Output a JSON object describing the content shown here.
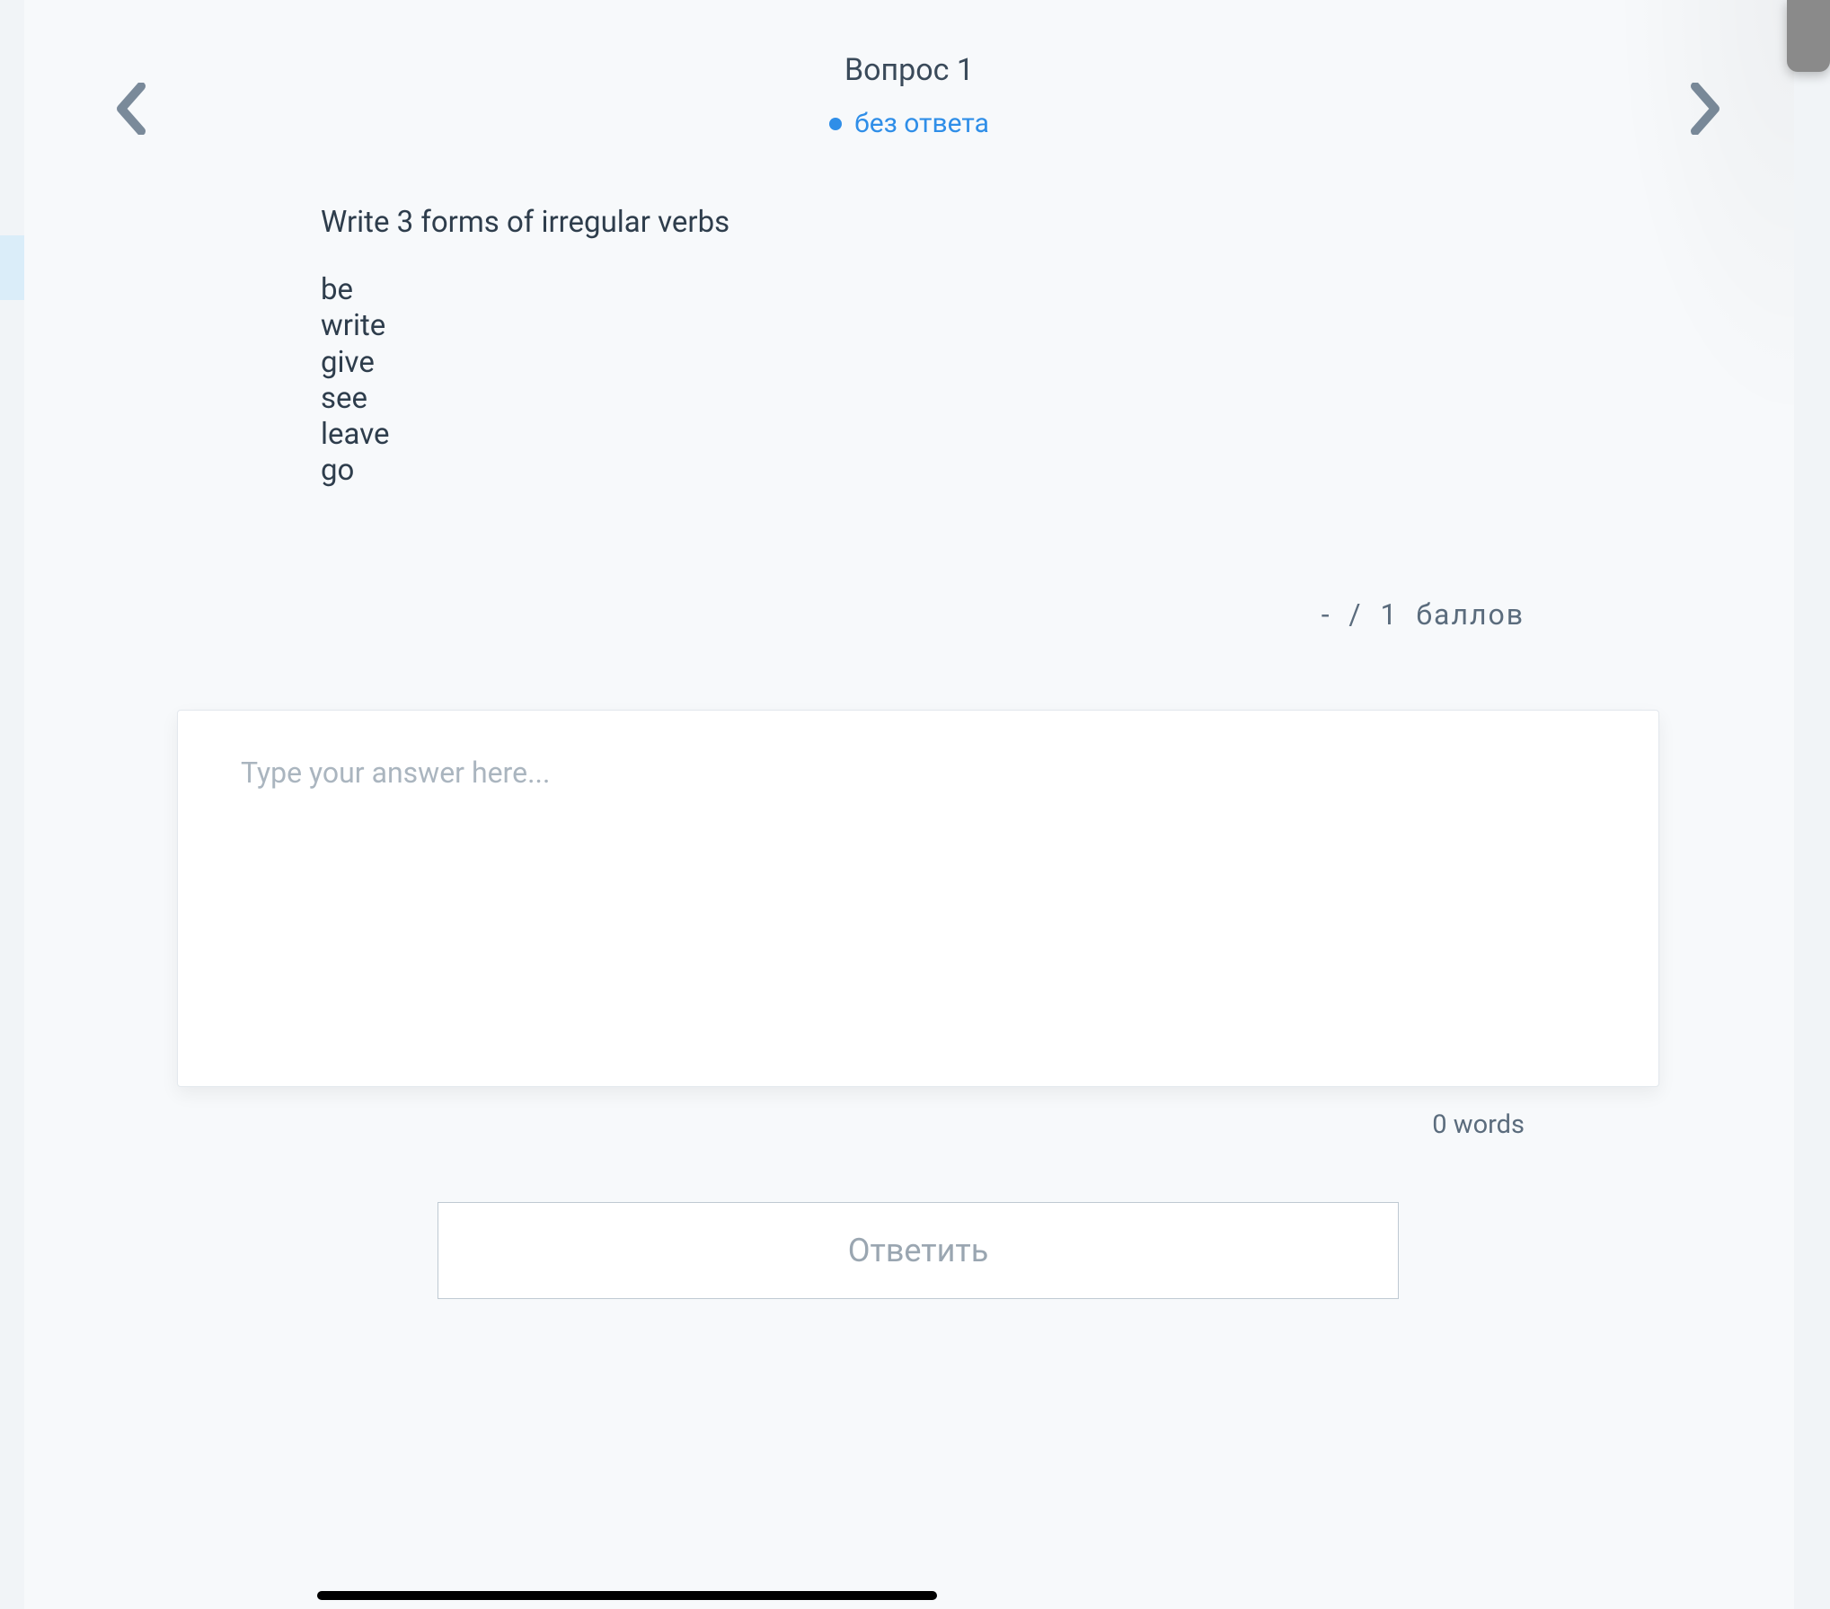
{
  "header": {
    "question_title": "Вопрос 1",
    "status_text": "без ответа"
  },
  "question": {
    "prompt": "Write 3 forms of irregular verbs",
    "verbs": "be\nwrite\ngive\nsee\nleave\ngo"
  },
  "points": {
    "earned": "-",
    "separator": "/",
    "max": "1",
    "label": "баллов"
  },
  "answer": {
    "placeholder": "Type your answer here...",
    "value": ""
  },
  "word_count": {
    "count": "0",
    "label": "words"
  },
  "submit": {
    "label": "Ответить"
  }
}
